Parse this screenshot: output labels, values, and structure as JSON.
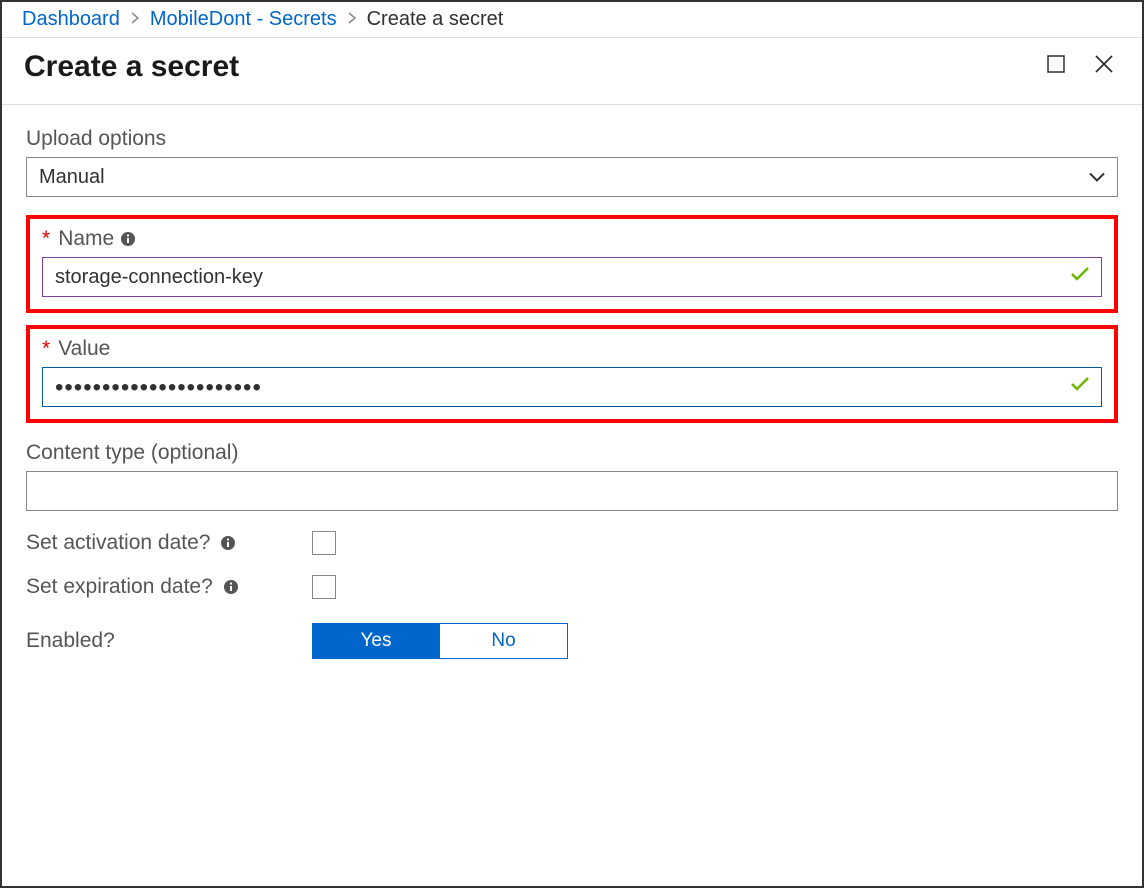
{
  "breadcrumb": {
    "items": [
      {
        "label": "Dashboard",
        "link": true
      },
      {
        "label": "MobileDont - Secrets",
        "link": true
      },
      {
        "label": "Create a secret",
        "link": false
      }
    ]
  },
  "header": {
    "title": "Create a secret"
  },
  "form": {
    "upload_options": {
      "label": "Upload options",
      "value": "Manual"
    },
    "name": {
      "label": "Name",
      "value": "storage-connection-key"
    },
    "value": {
      "label": "Value",
      "masked": "••••••••••••••••••••••"
    },
    "content_type": {
      "label": "Content type (optional)",
      "value": ""
    },
    "activation": {
      "label": "Set activation date?",
      "checked": false
    },
    "expiration": {
      "label": "Set expiration date?",
      "checked": false
    },
    "enabled": {
      "label": "Enabled?",
      "yes": "Yes",
      "no": "No",
      "selected": "Yes"
    }
  }
}
